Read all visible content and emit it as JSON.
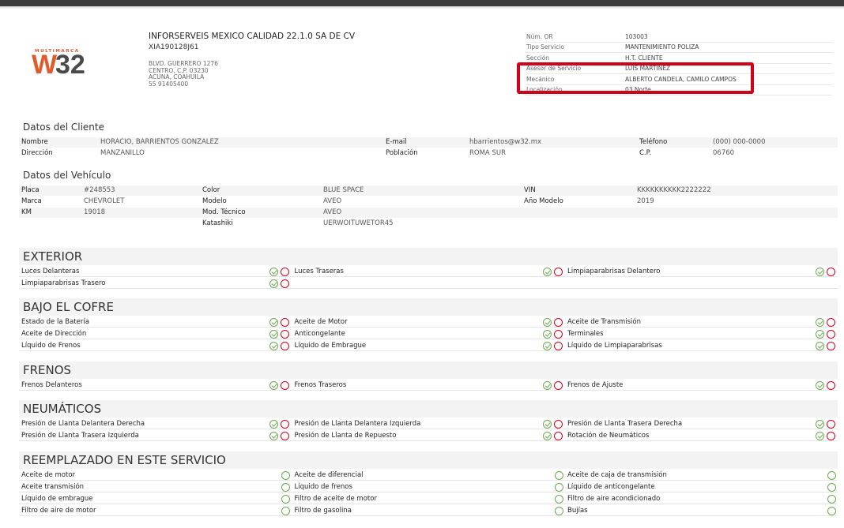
{
  "logo": {
    "top": "MULTIMARCA",
    "w": "W",
    "num": "32"
  },
  "company": {
    "name": "INFORSERVEIS MEXICO CALIDAD 22.1.0 SA DE CV",
    "rfc": "XIA190128J61",
    "address": [
      "BLVD. GUERRERO 1276",
      "CENTRO, C.P. 03230",
      "ACUNA, COAHUILA",
      "55 91405400"
    ]
  },
  "order": [
    {
      "k": "Núm. OR",
      "v": "103003"
    },
    {
      "k": "Tipo Servicio",
      "v": "MANTENIMIENTO POLIZA"
    },
    {
      "k": "Sección",
      "v": "H.T. CLIENTE"
    },
    {
      "k": "Asesor de Servicio",
      "v": "LUIS MARTINEZ"
    },
    {
      "k": "Mecánico",
      "v": "ALBERTO CANDELA, CAMILO CAMPOS"
    },
    {
      "k": "Localización",
      "v": "03 Norte"
    }
  ],
  "cliente": {
    "title": "Datos del Cliente",
    "rows": [
      [
        [
          "Nombre",
          "HORACIO, BARRIENTOS GONZALEZ"
        ],
        [
          "E-mail",
          "hbarrientos@w32.mx"
        ],
        [
          "Teléfono",
          "(000) 000-0000"
        ]
      ],
      [
        [
          "Dirección",
          "MANZANILLO"
        ],
        [
          "Población",
          "ROMA SUR"
        ],
        [
          "C.P.",
          "06760"
        ]
      ]
    ]
  },
  "vehiculo": {
    "title": "Datos del Vehículo",
    "rows": [
      [
        [
          "Placa",
          "#248553"
        ],
        [
          "Color",
          "BLUE SPACE"
        ],
        [
          "VIN",
          "KKKKKKKKKK2222222"
        ]
      ],
      [
        [
          "Marca",
          "CHEVROLET"
        ],
        [
          "Modelo",
          "AVEO"
        ],
        [
          "Año Modelo",
          "2019"
        ]
      ],
      [
        [
          "KM",
          "19018"
        ],
        [
          "Mod. Técnico",
          "AVEO"
        ],
        [
          "",
          ""
        ]
      ],
      [
        [
          "",
          ""
        ],
        [
          "Katashiki",
          "UERWOITUWETOR45"
        ],
        [
          "",
          ""
        ]
      ]
    ]
  },
  "sections": [
    {
      "title": "EXTERIOR",
      "mode": "check",
      "items": [
        "Luces Delanteras",
        "Luces Traseras",
        "Limpiaparabrisas Delantero",
        "Limpiaparabrisas Trasero"
      ]
    },
    {
      "title": "BAJO EL COFRE",
      "mode": "check",
      "items": [
        "Estado de la Batería",
        "Aceite de Motor",
        "Aceite de Transmisión",
        "Aceite de Dirección",
        "Anticongelante",
        "Terminales",
        "Líquido de Frenos",
        "Líquido de Embrague",
        "Líquido de Limpiaparabrisas"
      ]
    },
    {
      "title": "FRENOS",
      "mode": "check",
      "items": [
        "Frenos Delanteros",
        "Frenos Traseros",
        "Frenos de Ajuste"
      ]
    },
    {
      "title": "NEUMÁTICOS",
      "mode": "check",
      "items": [
        "Presión de Llanta Delantera Derecha",
        "Presión de Llanta Delantera Izquierda",
        "Presión de Llanta Trasera Derecha",
        "Presión de Llanta Trasera Izquierda",
        "Presión de Llanta de Repuesto",
        "Rotación de Neumáticos"
      ]
    },
    {
      "title": "REEMPLAZADO EN ESTE SERVICIO",
      "mode": "single",
      "items": [
        "Aceite de motor",
        "Aceite de diferencial",
        "Aceite de caja de transmisión",
        "Aceite transmisión",
        "Líquido de frenos",
        "Líquido de anticongelante",
        "Líquido de embrague",
        "Filtro de aceite de motor",
        "Filtro de aire acondicionado",
        "Filtro de aire de motor",
        "Filtro de gasolina",
        "Bujías"
      ]
    }
  ]
}
